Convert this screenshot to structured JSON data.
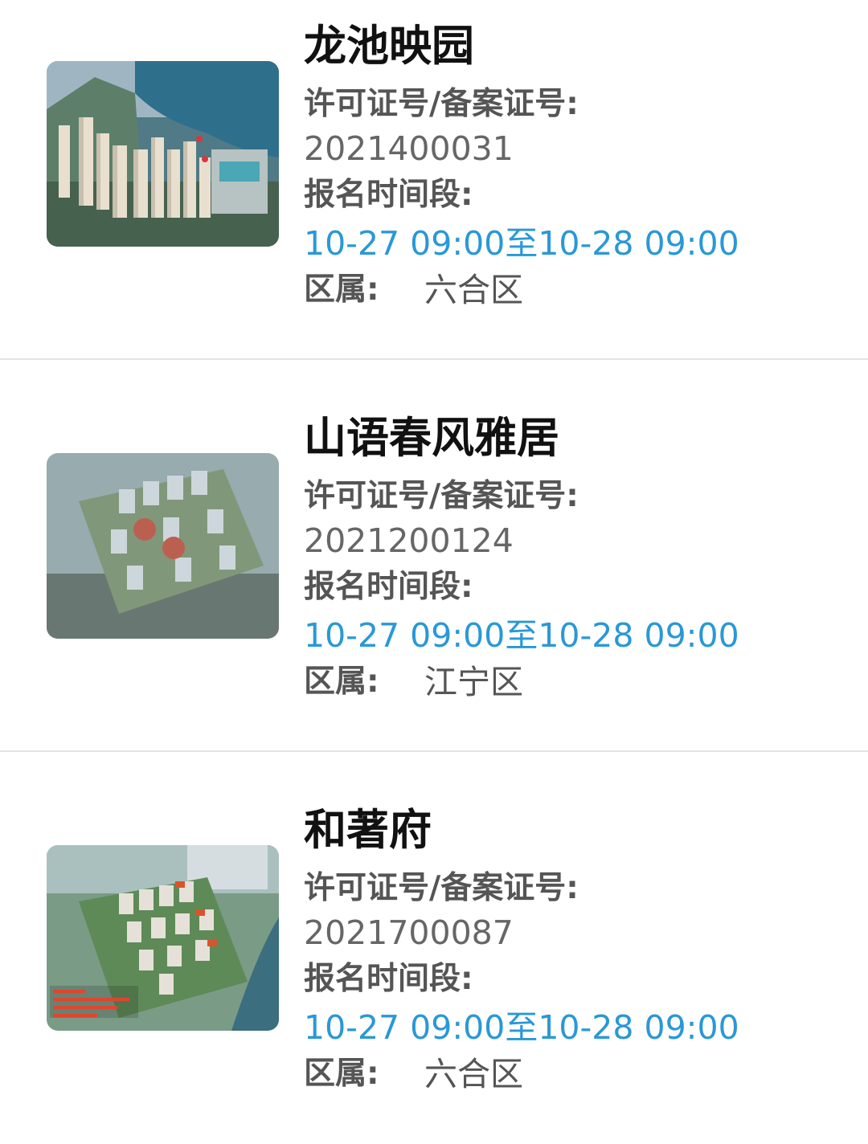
{
  "listings": [
    {
      "name": "龙池映园",
      "license_label": "许可证号/备案证号:",
      "license_number": "2021400031",
      "period_label": "报名时间段:",
      "period": "10-27 09:00至10-28 09:00",
      "district_label": "区属:",
      "district": "六合区",
      "thumbnail": "aerial-rendering-lakeside"
    },
    {
      "name": "山语春风雅居",
      "license_label": "许可证号/备案证号:",
      "license_number": "2021200124",
      "period_label": "报名时间段:",
      "period": "10-27 09:00至10-28 09:00",
      "district_label": "区属:",
      "district": "江宁区",
      "thumbnail": "aerial-rendering-blurry"
    },
    {
      "name": "和著府",
      "license_label": "许可证号/备案证号:",
      "license_number": "2021700087",
      "period_label": "报名时间段:",
      "period": "10-27 09:00至10-28 09:00",
      "district_label": "区属:",
      "district": "六合区",
      "thumbnail": "aerial-rendering-river"
    }
  ],
  "colors": {
    "title": "#111111",
    "label": "#555555",
    "value": "#666666",
    "time_accent": "#2a98d6",
    "divider": "#e3e3e3"
  }
}
